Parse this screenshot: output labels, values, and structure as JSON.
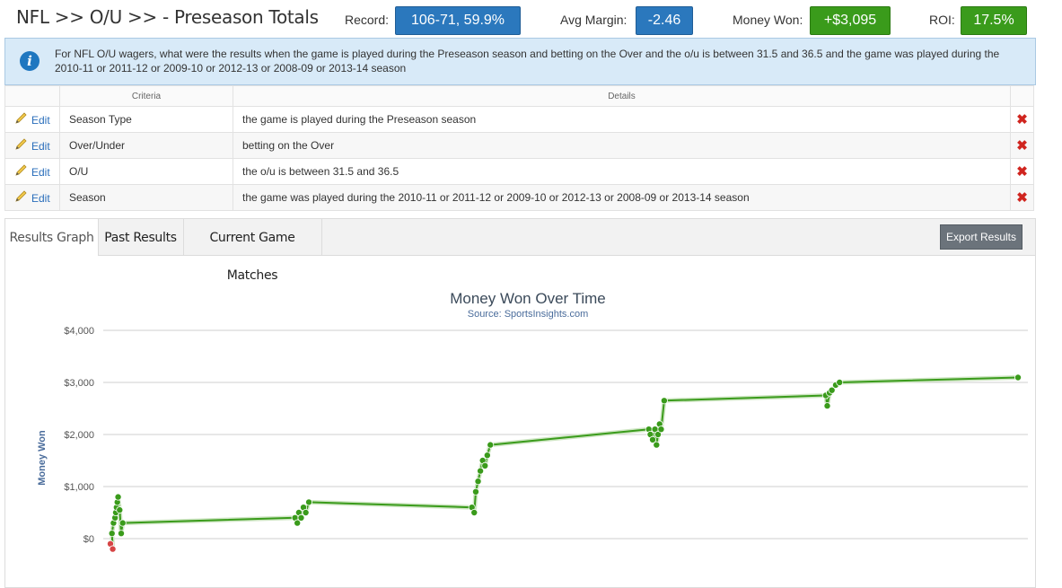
{
  "header": {
    "title": "NFL >> O/U >> - Preseason Totals",
    "record_label": "Record:",
    "record_value": "106-71, 59.9%",
    "avg_margin_label": "Avg Margin:",
    "avg_margin_value": "-2.46",
    "money_won_label": "Money Won:",
    "money_won_value": "+$3,095",
    "roi_label": "ROI:",
    "roi_value": "17.5%"
  },
  "info": {
    "text": "For NFL O/U wagers, what were the results when the game is played during the Preseason season and betting on the Over and the o/u is between 31.5 and 36.5 and the game was played during the 2010-11 or 2011-12 or 2009-10 or 2012-13 or 2008-09 or 2013-14 season"
  },
  "criteria": {
    "col_criteria": "Criteria",
    "col_details": "Details",
    "edit_label": "Edit",
    "rows": [
      {
        "criteria": "Season Type",
        "details": "the game is played during the Preseason season"
      },
      {
        "criteria": "Over/Under",
        "details": "betting on the Over"
      },
      {
        "criteria": "O/U",
        "details": "the o/u is between 31.5 and 36.5"
      },
      {
        "criteria": "Season",
        "details": "the game was played during the 2010-11 or 2011-12 or 2009-10 or 2012-13 or 2008-09 or 2013-14 season"
      }
    ]
  },
  "tabs": [
    "Results Graph",
    "Past Results",
    "Current Game Matches"
  ],
  "export_label": "Export Results",
  "colors": {
    "line": "#3a9b1b",
    "point": "#3a9b1b",
    "negative_point": "#d64545",
    "grid": "#cfcfcf"
  },
  "chart_data": {
    "type": "line",
    "title": "Money Won Over Time",
    "subtitle": "Source: SportsInsights.com",
    "ylabel": "Money Won",
    "xlabel": "",
    "ylim": [
      0,
      4000
    ],
    "yticks": [
      "$0",
      "$1,000",
      "$2,000",
      "$3,000",
      "$4,000"
    ],
    "ytick_values": [
      0,
      1000,
      2000,
      3000,
      4000
    ],
    "grid": true,
    "series": [
      {
        "values": [
          -100,
          -200,
          100,
          300,
          400,
          500,
          600,
          700,
          800,
          550,
          100,
          300,
          400,
          300,
          500,
          400,
          600,
          500,
          700,
          600,
          500,
          900,
          1100,
          1300,
          1500,
          1400,
          1600,
          1800,
          2100,
          2000,
          1900,
          2100,
          1800,
          2000,
          2200,
          2100,
          2650,
          2750,
          2550,
          2800,
          2850,
          2950,
          3000,
          3095
        ],
        "x": [
          0.0,
          0.3,
          0.2,
          0.4,
          0.6,
          0.7,
          0.8,
          0.9,
          1.0,
          1.2,
          1.4,
          1.6,
          24.0,
          24.3,
          24.5,
          24.8,
          25.1,
          25.4,
          25.8,
          47.0,
          47.3,
          47.5,
          47.8,
          48.1,
          48.4,
          48.7,
          49.0,
          49.4,
          70.0,
          70.2,
          70.5,
          70.8,
          71.0,
          71.2,
          71.4,
          71.6,
          72.0,
          93.0,
          93.2,
          93.5,
          93.8,
          94.3,
          94.8,
          118.0
        ]
      }
    ]
  }
}
